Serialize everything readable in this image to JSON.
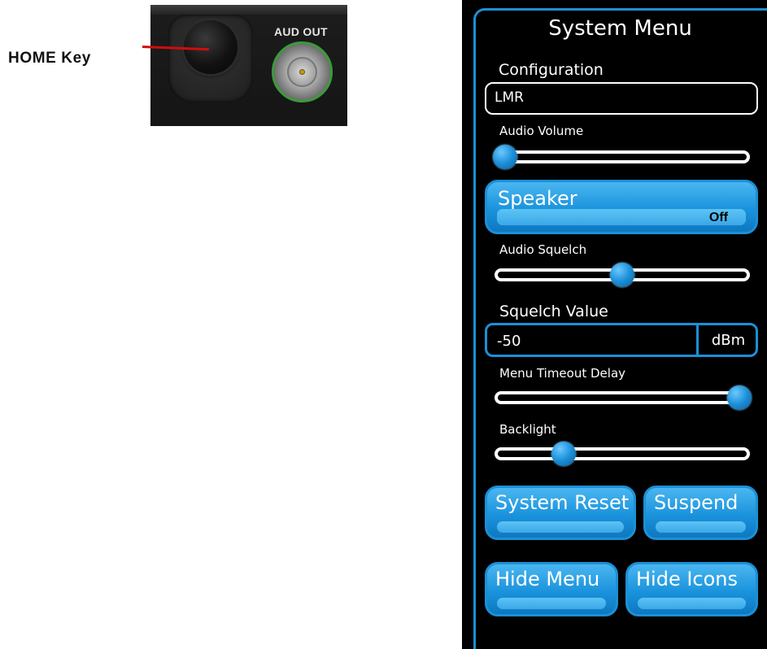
{
  "callout": {
    "label": "HOME Key"
  },
  "hardware": {
    "aud_out_label": "AUD OUT"
  },
  "menu": {
    "title": "System Menu",
    "configuration": {
      "label": "Configuration",
      "value": "LMR"
    },
    "audio_volume": {
      "label": "Audio Volume",
      "level": 0.0
    },
    "speaker": {
      "label": "Speaker",
      "state": "Off"
    },
    "audio_squelch": {
      "label": "Audio Squelch",
      "level": 0.5
    },
    "squelch_value": {
      "label": "Squelch Value",
      "value": "-50",
      "unit": "dBm"
    },
    "menu_timeout_delay": {
      "label": "Menu Timeout Delay",
      "level": 1.0
    },
    "backlight": {
      "label": "Backlight",
      "level": 0.25
    },
    "buttons": {
      "system_reset": "System Reset",
      "suspend": "Suspend",
      "hide_menu": "Hide Menu",
      "hide_icons": "Hide Icons"
    }
  },
  "colors": {
    "accent": "#1b90d6",
    "callout_line": "#d00d0d",
    "connector_ring": "#3c9a3c"
  }
}
